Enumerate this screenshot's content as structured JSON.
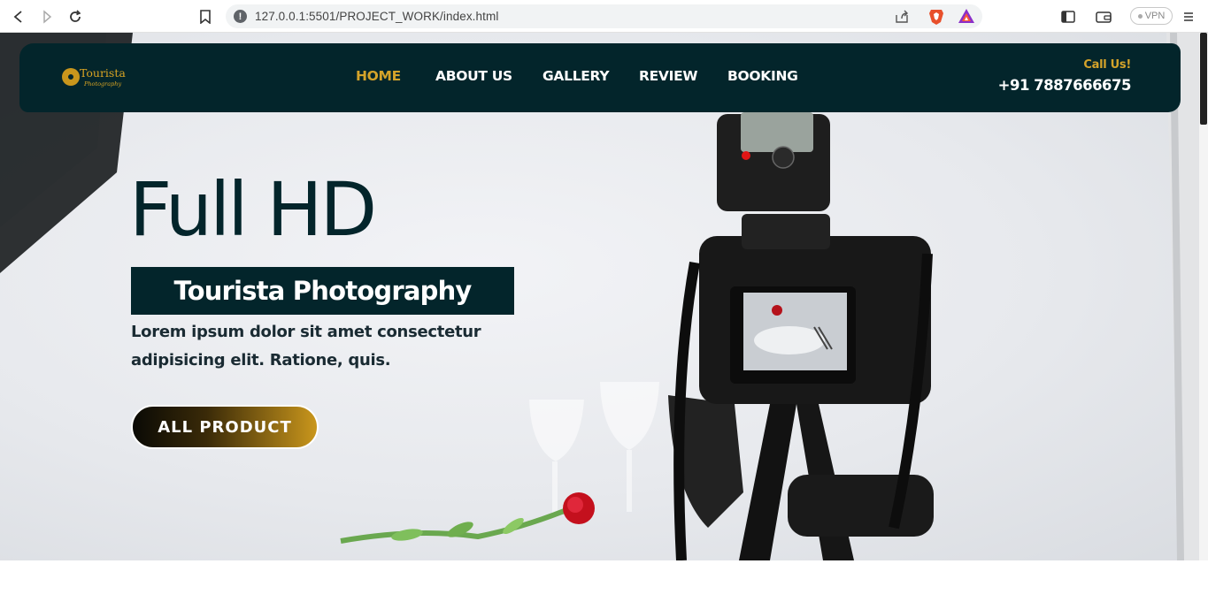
{
  "browser": {
    "url": "127.0.0.1:5501/PROJECT_WORK/index.html",
    "vpn_label": "VPN"
  },
  "brand": {
    "name": "Tourista",
    "tagline": "Photography",
    "accent_color": "#d4a32a",
    "dark_color": "#03252b"
  },
  "nav": {
    "items": [
      {
        "label": "HOME",
        "active": true
      },
      {
        "label": "ABOUT US",
        "active": false
      },
      {
        "label": "GALLERY",
        "active": false
      },
      {
        "label": "REVIEW",
        "active": false
      },
      {
        "label": "BOOKING",
        "active": false
      }
    ]
  },
  "contact": {
    "call_label": "Call Us!",
    "phone": "+91 7887666675"
  },
  "hero": {
    "headline": "Full HD",
    "subtitle": "Tourista Photography",
    "description": "Lorem ipsum dolor sit amet consectetur adipisicing elit. Ratione, quis.",
    "cta_label": "ALL PRODUCT"
  },
  "icons": {
    "back": "back-arrow-icon",
    "forward": "forward-arrow-icon",
    "reload": "reload-icon",
    "bookmark": "bookmark-icon",
    "site_info": "info-icon",
    "share": "share-icon",
    "brave": "brave-shield-icon",
    "rewards": "brave-rewards-icon",
    "sidebar": "sidebar-icon",
    "wallet": "wallet-icon",
    "menu": "hamburger-menu-icon"
  }
}
